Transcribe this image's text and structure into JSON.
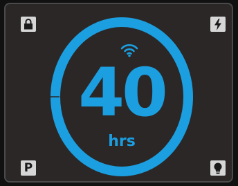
{
  "display": {
    "value": "40",
    "unit": "hrs"
  },
  "icons": {
    "top_left": "lock-icon",
    "top_right": "lightning-bolt-icon",
    "bottom_left_letter": "P",
    "bottom_right": "lightbulb-icon",
    "center": "wifi-icon"
  },
  "colors": {
    "accent": "#1b9fe0",
    "panel_background": "#2b2727",
    "icon_tile": "#d6d6d6"
  }
}
